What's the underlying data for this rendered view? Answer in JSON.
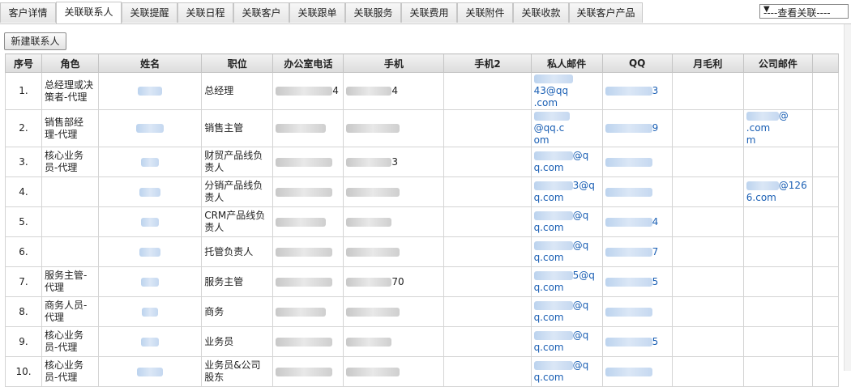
{
  "tabs": [
    {
      "label": "客户详情",
      "active": false
    },
    {
      "label": "关联联系人",
      "active": true
    },
    {
      "label": "关联提醒",
      "active": false
    },
    {
      "label": "关联日程",
      "active": false
    },
    {
      "label": "关联客户",
      "active": false
    },
    {
      "label": "关联跟单",
      "active": false
    },
    {
      "label": "关联服务",
      "active": false
    },
    {
      "label": "关联费用",
      "active": false
    },
    {
      "label": "关联附件",
      "active": false
    },
    {
      "label": "关联收款",
      "active": false
    },
    {
      "label": "关联客户产品",
      "active": false
    }
  ],
  "view_select": {
    "selected": "----查看关联----"
  },
  "new_contact_button": "新建联系人",
  "columns": [
    "序号",
    "角色",
    "姓名",
    "职位",
    "办公室电话",
    "手机",
    "手机2",
    "私人邮件",
    "QQ",
    "月毛利",
    "公司邮件"
  ],
  "rows": [
    {
      "index": "1.",
      "role": "总经理或决策者-代理",
      "title": "总经理",
      "office_tail": "4",
      "mobile_tail": "4",
      "email_a": "43@qq",
      "email_b": ".com",
      "qq_tail": "3",
      "company_email_a": "",
      "company_email_b": ""
    },
    {
      "index": "2.",
      "role": "销售部经理-代理",
      "title": "销售主管",
      "office_tail": "",
      "mobile_tail": "",
      "email_a": "@qq.c",
      "email_b": "om",
      "qq_tail": "9",
      "company_email_a": "@ .com",
      "company_email_b": "m"
    },
    {
      "index": "3.",
      "role": "核心业务员-代理",
      "title": "财贸产品线负责人",
      "office_tail": "",
      "mobile_tail": "3",
      "email_a": "@q",
      "email_b": "q.com",
      "qq_tail": "",
      "company_email_a": "",
      "company_email_b": ""
    },
    {
      "index": "4.",
      "role": "",
      "title": "分销产品线负责人",
      "office_tail": "",
      "mobile_tail": "",
      "email_a": "3@q",
      "email_b": "q.com",
      "qq_tail": "",
      "company_email_a": "@126",
      "company_email_b": "6.com"
    },
    {
      "index": "5.",
      "role": "",
      "title": "CRM产品线负责人",
      "office_tail": "",
      "mobile_tail": "",
      "email_a": "@q",
      "email_b": "q.com",
      "qq_tail": "4",
      "company_email_a": "",
      "company_email_b": ""
    },
    {
      "index": "6.",
      "role": "",
      "title": "托管负责人",
      "office_tail": "",
      "mobile_tail": "",
      "email_a": "@q",
      "email_b": "q.com",
      "qq_tail": "7",
      "company_email_a": "",
      "company_email_b": ""
    },
    {
      "index": "7.",
      "role": "服务主管-代理",
      "title": "服务主管",
      "office_tail": "",
      "mobile_tail": "70",
      "email_a": "5@q",
      "email_b": "q.com",
      "qq_tail": "5",
      "company_email_a": "",
      "company_email_b": ""
    },
    {
      "index": "8.",
      "role": "商务人员-代理",
      "title": "商务",
      "office_tail": "",
      "mobile_tail": "",
      "email_a": "@q",
      "email_b": "q.com",
      "qq_tail": "",
      "company_email_a": "",
      "company_email_b": ""
    },
    {
      "index": "9.",
      "role": "核心业务员-代理",
      "title": "业务员",
      "office_tail": "",
      "mobile_tail": "",
      "email_a": "@q",
      "email_b": "q.com",
      "qq_tail": "5",
      "company_email_a": "",
      "company_email_b": ""
    },
    {
      "index": "10.",
      "role": "核心业务员-代理",
      "title": "业务员&公司股东",
      "office_tail": "",
      "mobile_tail": "",
      "email_a": "@q",
      "email_b": "q.com",
      "qq_tail": "",
      "company_email_a": "",
      "company_email_b": ""
    }
  ]
}
